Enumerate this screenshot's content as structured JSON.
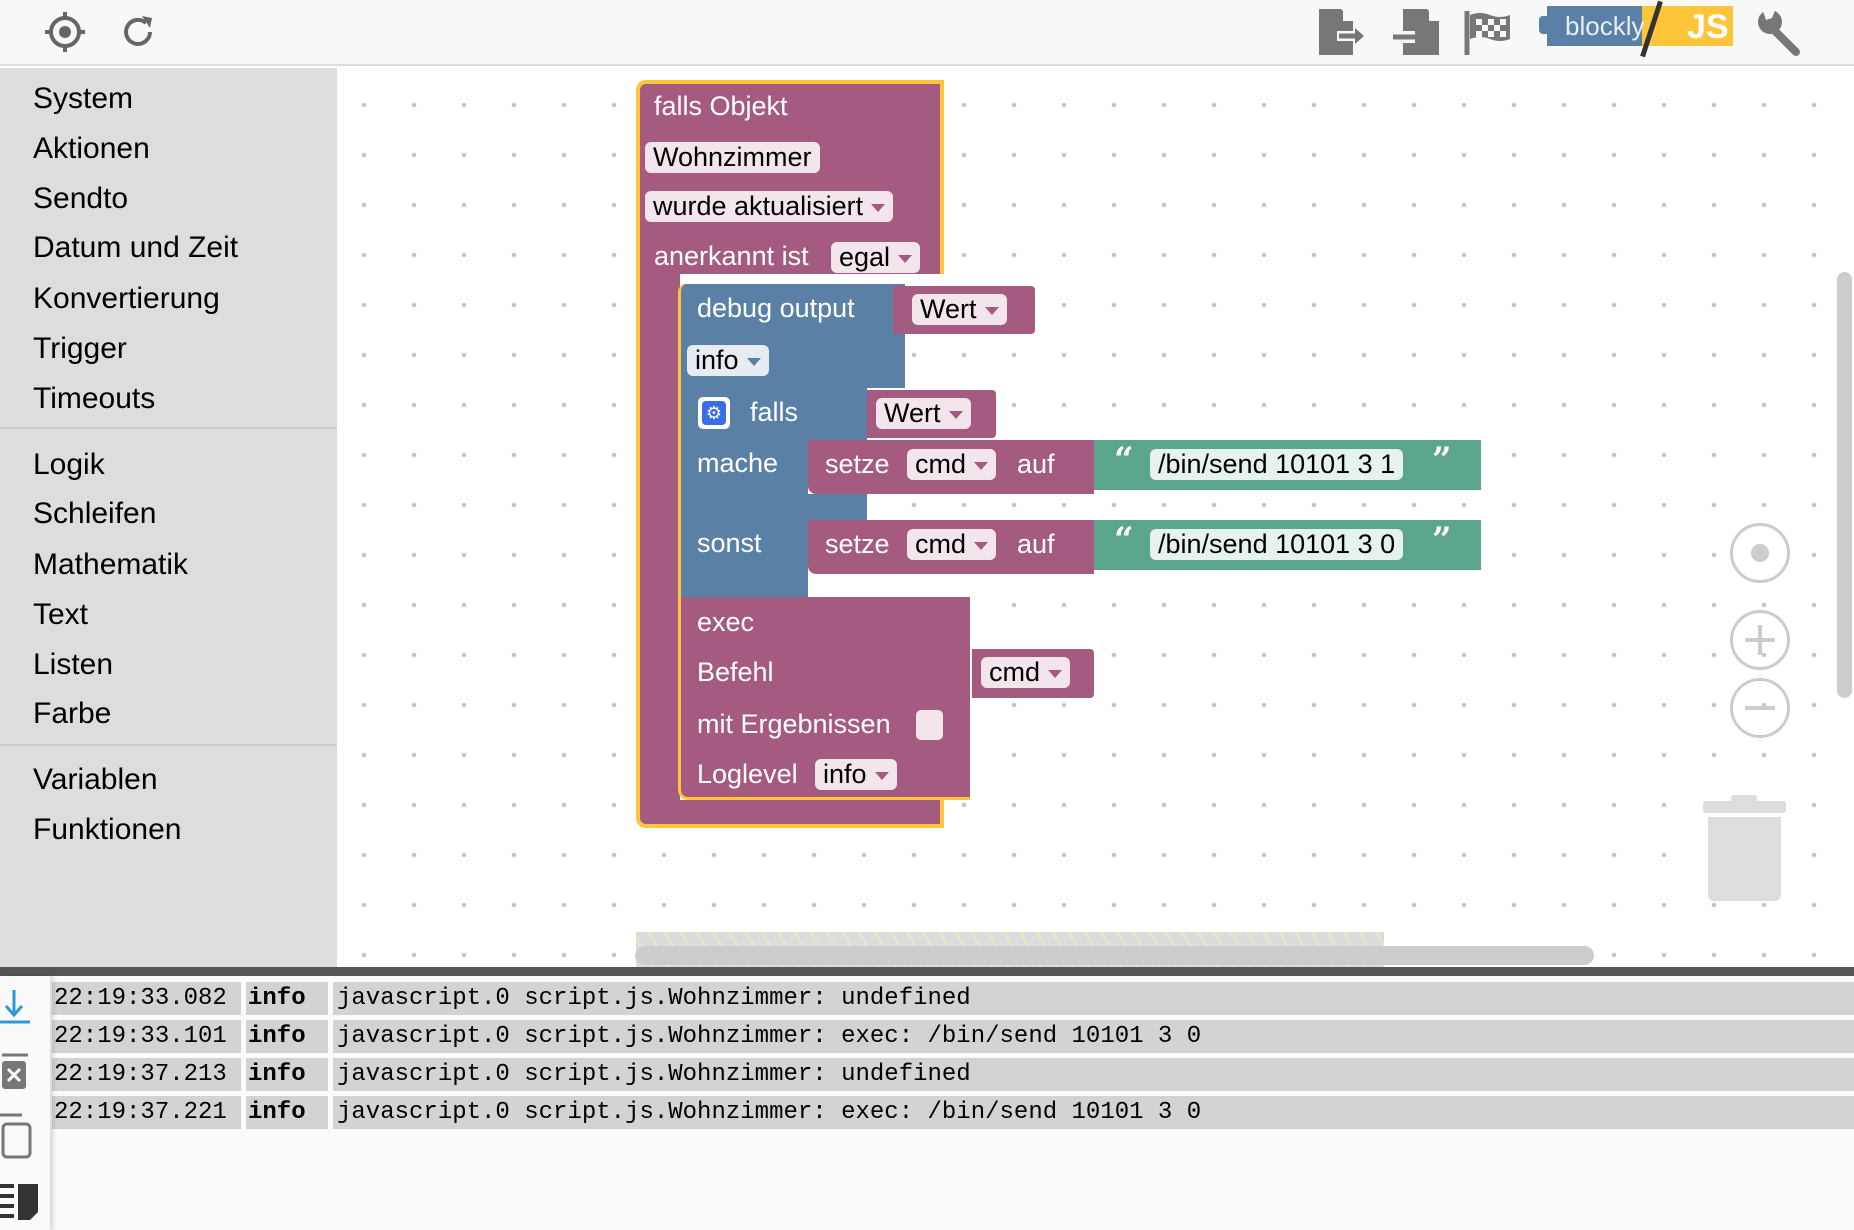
{
  "toolbar": {
    "left_icons": [
      "target-icon",
      "refresh-icon"
    ],
    "right_icons": [
      "export-icon",
      "import-icon",
      "flag-icon",
      "blockly-js-toggle",
      "wrench-icon"
    ],
    "logo": {
      "left": "blockly",
      "right": "JS"
    }
  },
  "sidebar": {
    "groups": [
      [
        "System",
        "Aktionen",
        "Sendto",
        "Datum und Zeit",
        "Konvertierung",
        "Trigger",
        "Timeouts"
      ],
      [
        "Logik",
        "Schleifen",
        "Mathematik",
        "Text",
        "Listen",
        "Farbe"
      ],
      [
        "Variablen",
        "Funktionen"
      ]
    ]
  },
  "blocks": {
    "trigger": {
      "title": "falls Objekt",
      "object": "Wohnzimmer",
      "event": "wurde aktualisiert",
      "ack_label": "anerkannt ist",
      "ack_value": "egal"
    },
    "debug": {
      "label": "debug output",
      "value": "Wert",
      "level": "info"
    },
    "if": {
      "label": "falls",
      "condition": "Wert",
      "do_label": "mache",
      "else_label": "sonst"
    },
    "set1": {
      "label": "setze",
      "var": "cmd",
      "to": "auf",
      "text": "/bin/send 10101 3 1"
    },
    "set2": {
      "label": "setze",
      "var": "cmd",
      "to": "auf",
      "text": "/bin/send 10101 3 0"
    },
    "exec": {
      "label": "exec",
      "command_label": "Befehl",
      "command": "cmd",
      "results_label": "mit Ergebnissen",
      "results_checked": false,
      "loglevel_label": "Loglevel",
      "loglevel": "info"
    },
    "quote_open": "“",
    "quote_close": "”"
  },
  "colors": {
    "logic_block": "#a55b80",
    "control_block": "#5b80a5",
    "text_block": "#5ba58c",
    "selection": "#fcc53a"
  },
  "log": {
    "rows": [
      {
        "time": "22:19:33.082",
        "level": "info",
        "msg": "javascript.0 script.js.Wohnzimmer: undefined"
      },
      {
        "time": "22:19:33.101",
        "level": "info",
        "msg": "javascript.0 script.js.Wohnzimmer: exec: /bin/send 10101 3 0"
      },
      {
        "time": "22:19:37.213",
        "level": "info",
        "msg": "javascript.0 script.js.Wohnzimmer: undefined"
      },
      {
        "time": "22:19:37.221",
        "level": "info",
        "msg": "javascript.0 script.js.Wohnzimmer: exec: /bin/send 10101 3 0"
      }
    ]
  }
}
